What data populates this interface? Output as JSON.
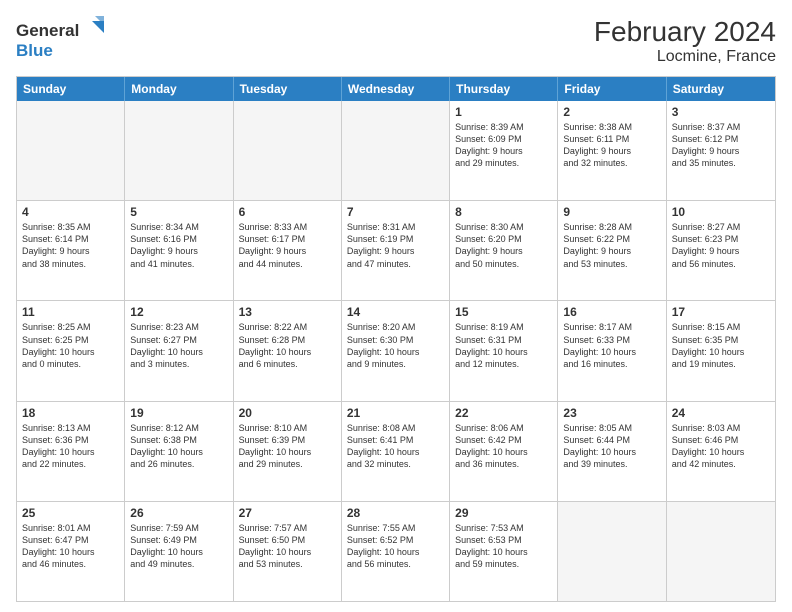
{
  "header": {
    "logo_line1": "General",
    "logo_line2": "Blue",
    "title": "February 2024",
    "subtitle": "Locmine, France"
  },
  "days_of_week": [
    "Sunday",
    "Monday",
    "Tuesday",
    "Wednesday",
    "Thursday",
    "Friday",
    "Saturday"
  ],
  "weeks": [
    [
      {
        "day": "",
        "info": "",
        "empty": true
      },
      {
        "day": "",
        "info": "",
        "empty": true
      },
      {
        "day": "",
        "info": "",
        "empty": true
      },
      {
        "day": "",
        "info": "",
        "empty": true
      },
      {
        "day": "1",
        "info": "Sunrise: 8:39 AM\nSunset: 6:09 PM\nDaylight: 9 hours\nand 29 minutes.",
        "empty": false
      },
      {
        "day": "2",
        "info": "Sunrise: 8:38 AM\nSunset: 6:11 PM\nDaylight: 9 hours\nand 32 minutes.",
        "empty": false
      },
      {
        "day": "3",
        "info": "Sunrise: 8:37 AM\nSunset: 6:12 PM\nDaylight: 9 hours\nand 35 minutes.",
        "empty": false
      }
    ],
    [
      {
        "day": "4",
        "info": "Sunrise: 8:35 AM\nSunset: 6:14 PM\nDaylight: 9 hours\nand 38 minutes.",
        "empty": false
      },
      {
        "day": "5",
        "info": "Sunrise: 8:34 AM\nSunset: 6:16 PM\nDaylight: 9 hours\nand 41 minutes.",
        "empty": false
      },
      {
        "day": "6",
        "info": "Sunrise: 8:33 AM\nSunset: 6:17 PM\nDaylight: 9 hours\nand 44 minutes.",
        "empty": false
      },
      {
        "day": "7",
        "info": "Sunrise: 8:31 AM\nSunset: 6:19 PM\nDaylight: 9 hours\nand 47 minutes.",
        "empty": false
      },
      {
        "day": "8",
        "info": "Sunrise: 8:30 AM\nSunset: 6:20 PM\nDaylight: 9 hours\nand 50 minutes.",
        "empty": false
      },
      {
        "day": "9",
        "info": "Sunrise: 8:28 AM\nSunset: 6:22 PM\nDaylight: 9 hours\nand 53 minutes.",
        "empty": false
      },
      {
        "day": "10",
        "info": "Sunrise: 8:27 AM\nSunset: 6:23 PM\nDaylight: 9 hours\nand 56 minutes.",
        "empty": false
      }
    ],
    [
      {
        "day": "11",
        "info": "Sunrise: 8:25 AM\nSunset: 6:25 PM\nDaylight: 10 hours\nand 0 minutes.",
        "empty": false
      },
      {
        "day": "12",
        "info": "Sunrise: 8:23 AM\nSunset: 6:27 PM\nDaylight: 10 hours\nand 3 minutes.",
        "empty": false
      },
      {
        "day": "13",
        "info": "Sunrise: 8:22 AM\nSunset: 6:28 PM\nDaylight: 10 hours\nand 6 minutes.",
        "empty": false
      },
      {
        "day": "14",
        "info": "Sunrise: 8:20 AM\nSunset: 6:30 PM\nDaylight: 10 hours\nand 9 minutes.",
        "empty": false
      },
      {
        "day": "15",
        "info": "Sunrise: 8:19 AM\nSunset: 6:31 PM\nDaylight: 10 hours\nand 12 minutes.",
        "empty": false
      },
      {
        "day": "16",
        "info": "Sunrise: 8:17 AM\nSunset: 6:33 PM\nDaylight: 10 hours\nand 16 minutes.",
        "empty": false
      },
      {
        "day": "17",
        "info": "Sunrise: 8:15 AM\nSunset: 6:35 PM\nDaylight: 10 hours\nand 19 minutes.",
        "empty": false
      }
    ],
    [
      {
        "day": "18",
        "info": "Sunrise: 8:13 AM\nSunset: 6:36 PM\nDaylight: 10 hours\nand 22 minutes.",
        "empty": false
      },
      {
        "day": "19",
        "info": "Sunrise: 8:12 AM\nSunset: 6:38 PM\nDaylight: 10 hours\nand 26 minutes.",
        "empty": false
      },
      {
        "day": "20",
        "info": "Sunrise: 8:10 AM\nSunset: 6:39 PM\nDaylight: 10 hours\nand 29 minutes.",
        "empty": false
      },
      {
        "day": "21",
        "info": "Sunrise: 8:08 AM\nSunset: 6:41 PM\nDaylight: 10 hours\nand 32 minutes.",
        "empty": false
      },
      {
        "day": "22",
        "info": "Sunrise: 8:06 AM\nSunset: 6:42 PM\nDaylight: 10 hours\nand 36 minutes.",
        "empty": false
      },
      {
        "day": "23",
        "info": "Sunrise: 8:05 AM\nSunset: 6:44 PM\nDaylight: 10 hours\nand 39 minutes.",
        "empty": false
      },
      {
        "day": "24",
        "info": "Sunrise: 8:03 AM\nSunset: 6:46 PM\nDaylight: 10 hours\nand 42 minutes.",
        "empty": false
      }
    ],
    [
      {
        "day": "25",
        "info": "Sunrise: 8:01 AM\nSunset: 6:47 PM\nDaylight: 10 hours\nand 46 minutes.",
        "empty": false
      },
      {
        "day": "26",
        "info": "Sunrise: 7:59 AM\nSunset: 6:49 PM\nDaylight: 10 hours\nand 49 minutes.",
        "empty": false
      },
      {
        "day": "27",
        "info": "Sunrise: 7:57 AM\nSunset: 6:50 PM\nDaylight: 10 hours\nand 53 minutes.",
        "empty": false
      },
      {
        "day": "28",
        "info": "Sunrise: 7:55 AM\nSunset: 6:52 PM\nDaylight: 10 hours\nand 56 minutes.",
        "empty": false
      },
      {
        "day": "29",
        "info": "Sunrise: 7:53 AM\nSunset: 6:53 PM\nDaylight: 10 hours\nand 59 minutes.",
        "empty": false
      },
      {
        "day": "",
        "info": "",
        "empty": true
      },
      {
        "day": "",
        "info": "",
        "empty": true
      }
    ]
  ]
}
